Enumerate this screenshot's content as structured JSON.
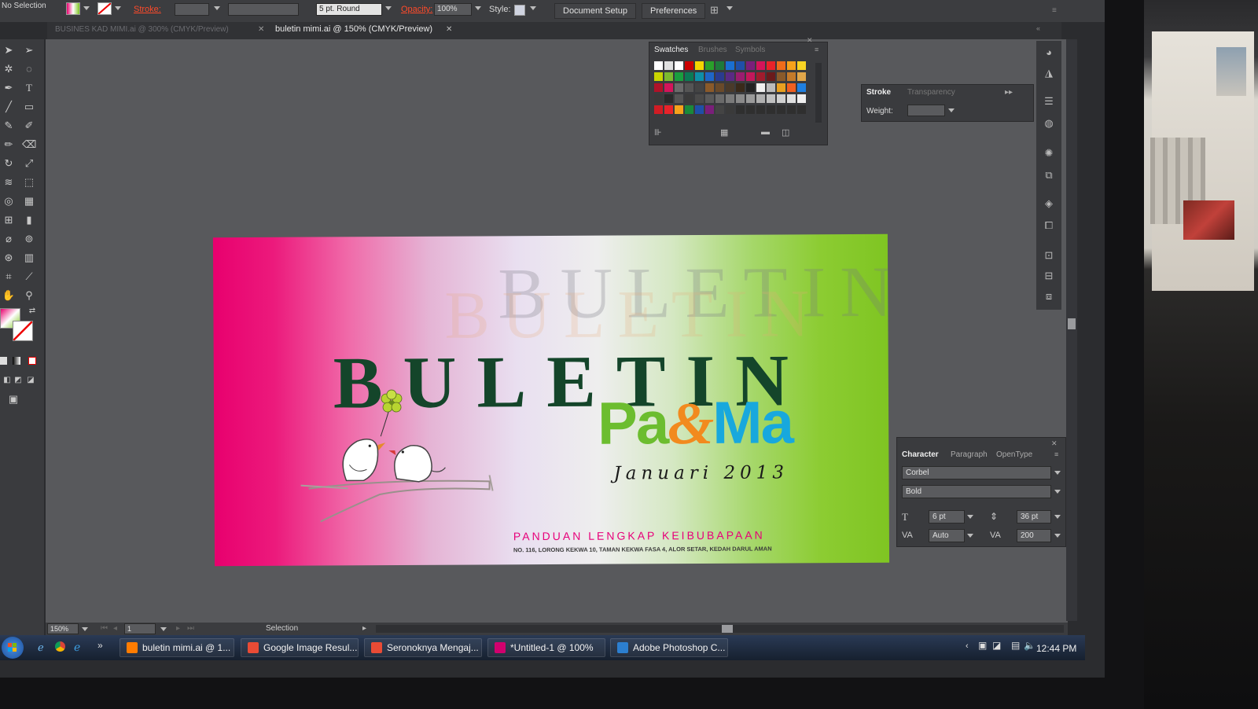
{
  "control_bar": {
    "selection_status": "No Selection",
    "stroke_label": "Stroke:",
    "brush_value": "5 pt. Round",
    "opacity_label": "Opacity:",
    "opacity_value": "100%",
    "style_label": "Style:",
    "document_setup_button": "Document Setup",
    "preferences_button": "Preferences"
  },
  "tabs": [
    {
      "label": "BUSINES KAD MIMI.ai @ 300% (CMYK/Preview)",
      "active": false
    },
    {
      "label": "buletin mimi.ai @ 150% (CMYK/Preview)",
      "active": true
    }
  ],
  "artwork": {
    "title": "BULETIN",
    "ghost_title": "BULETIN",
    "pama": [
      "Pa",
      "&",
      "Ma"
    ],
    "date": "Januari 2013",
    "tagline": "PANDUAN LENGKAP KEIBUBAPAAN",
    "address": "NO. 116, LORONG KEKWA 10, TAMAN KEKWA FASA 4, ALOR SETAR, KEDAH DARUL AMAN",
    "colors": {
      "pink": "#e8006e",
      "green": "#7fc522",
      "title_green": "#14452a",
      "pa_green": "#6cbd2f",
      "amp_orange": "#f28a1e",
      "ma_cyan": "#18a8dd",
      "a_pink": "#e8167c"
    }
  },
  "swatches_panel": {
    "tabs": [
      "Swatches",
      "Brushes",
      "Symbols"
    ],
    "active_tab": "Swatches"
  },
  "stroke_panel": {
    "tabs": [
      "Stroke",
      "Transparency"
    ],
    "weight_label": "Weight:"
  },
  "character_panel": {
    "tabs": [
      "Character",
      "Paragraph",
      "OpenType"
    ],
    "font_family": "Corbel",
    "font_style": "Bold",
    "font_size": "6 pt",
    "leading": "36 pt",
    "kerning": "Auto",
    "tracking": "200"
  },
  "status_bar": {
    "zoom": "150%",
    "page": "1",
    "tool": "Selection"
  },
  "taskbar": {
    "items": [
      {
        "label": "buletin mimi.ai @ 1...",
        "icon": "illustrator-icon",
        "color": "#ff7c00"
      },
      {
        "label": "Google Image Resul...",
        "icon": "chrome-icon",
        "color": "#e94b35"
      },
      {
        "label": "Seronoknya Mengaj...",
        "icon": "chrome-icon",
        "color": "#e94b35"
      },
      {
        "label": "*Untitled-1 @ 100%",
        "icon": "indesign-icon",
        "color": "#d1006e"
      },
      {
        "label": "Adobe Photoshop C...",
        "icon": "photoshop-icon",
        "color": "#2c7fd0"
      }
    ],
    "clock": "12:44 PM"
  }
}
